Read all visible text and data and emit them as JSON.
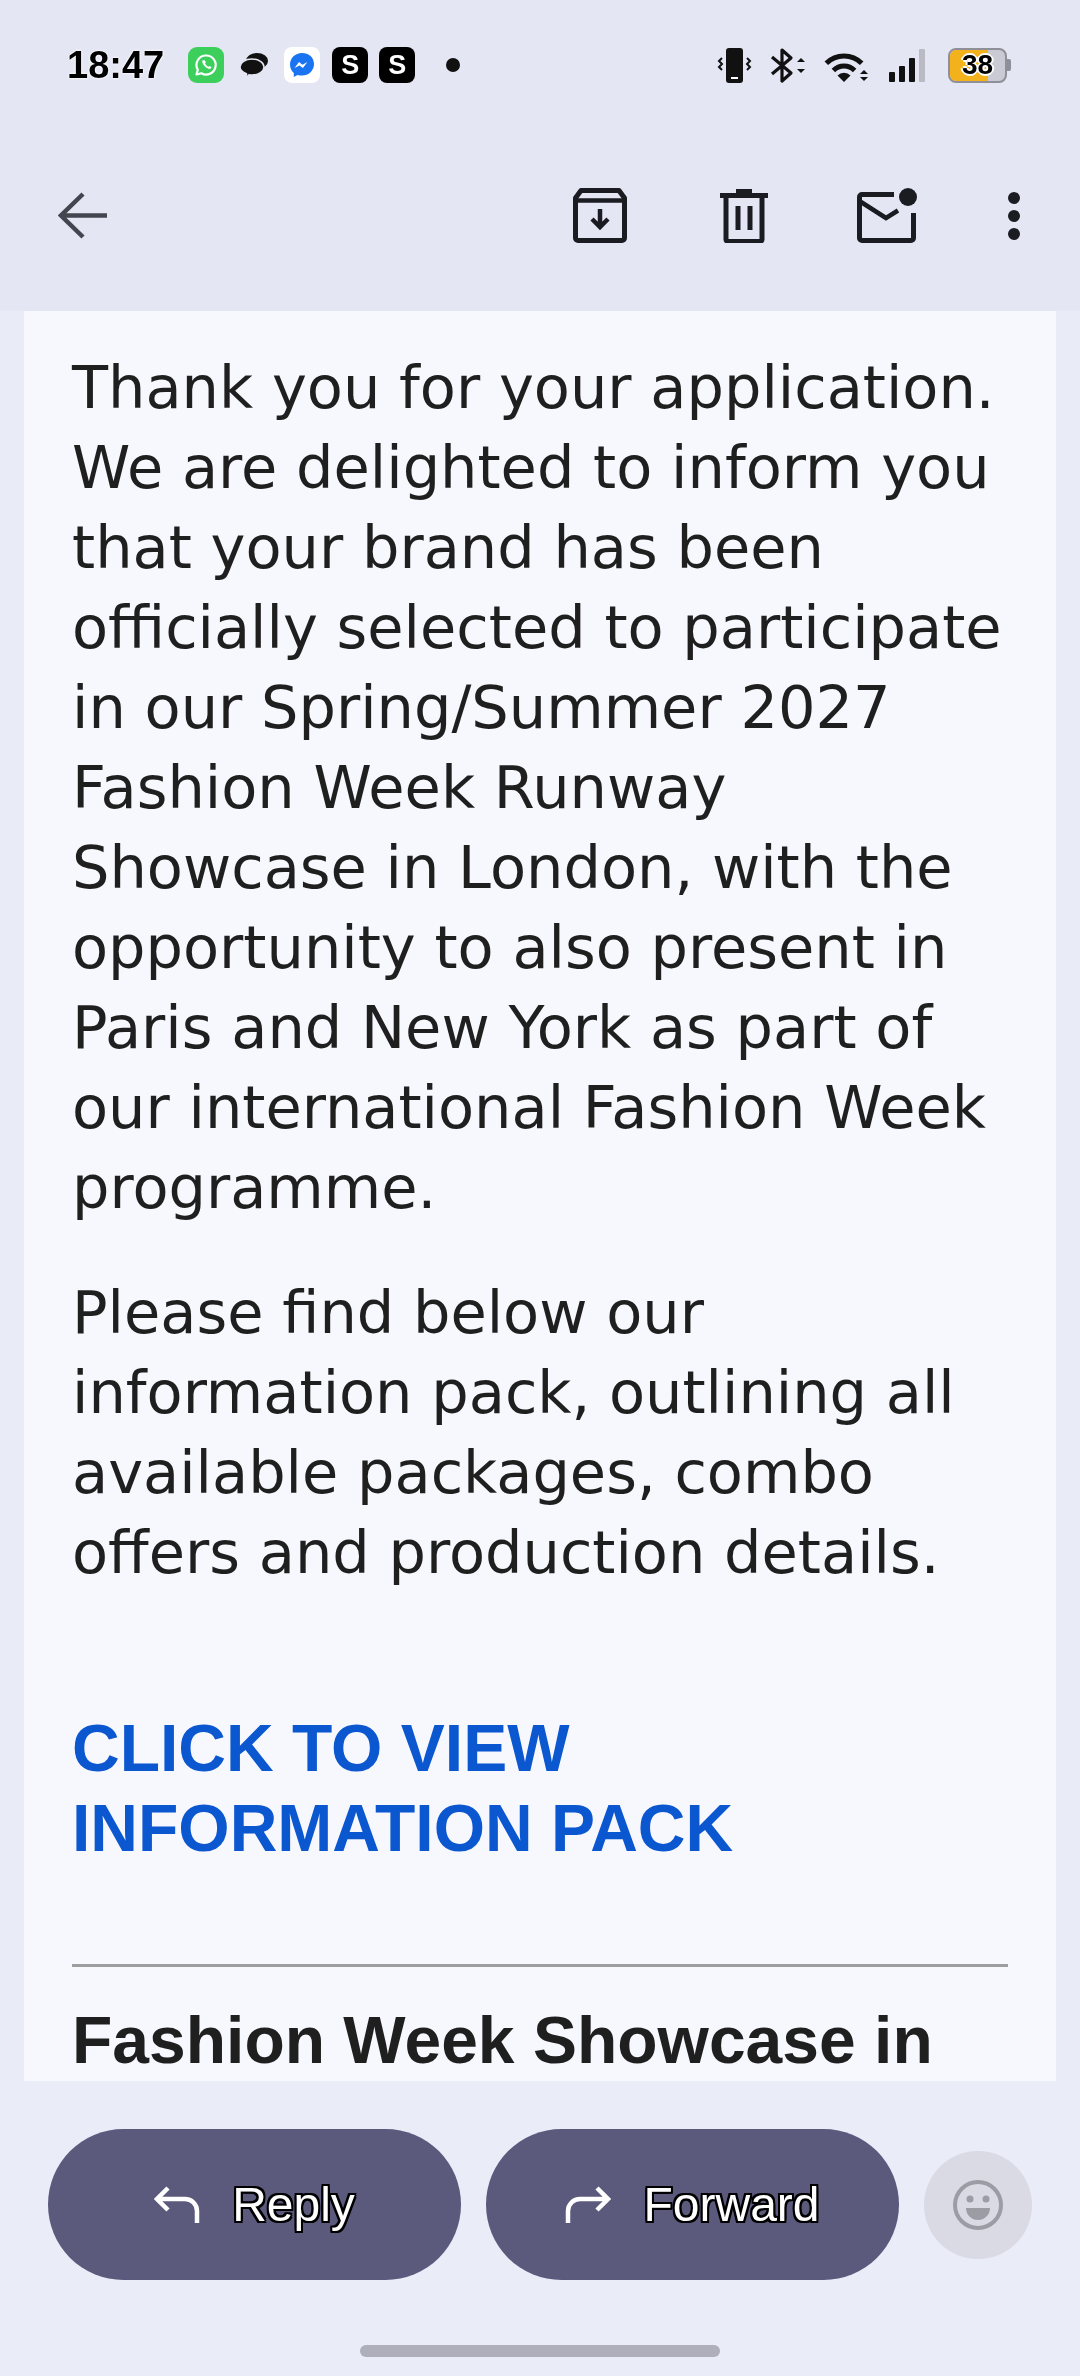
{
  "status_bar": {
    "time": "18:47",
    "app_tiles": [
      {
        "letter": "S"
      },
      {
        "letter": "S"
      }
    ],
    "battery": "38"
  },
  "email": {
    "paragraphs": [
      "Thank you for your application. We are delighted to inform you that your brand has been officially selected to participate in our Spring/Summer 2027 Fashion Week Runway Showcase in London, with the opportunity to also present in Paris and New York as part of our international Fashion Week programme.",
      "Please find below our information pack, outlining all available packages, combo offers and production details."
    ],
    "link": "CLICK TO VIEW INFORMATION PACK",
    "section_heading": "Fashion Week Showcase in"
  },
  "actions": [
    {
      "kind": "reply",
      "label": "Reply"
    },
    {
      "kind": "forward",
      "label": "Forward"
    }
  ]
}
